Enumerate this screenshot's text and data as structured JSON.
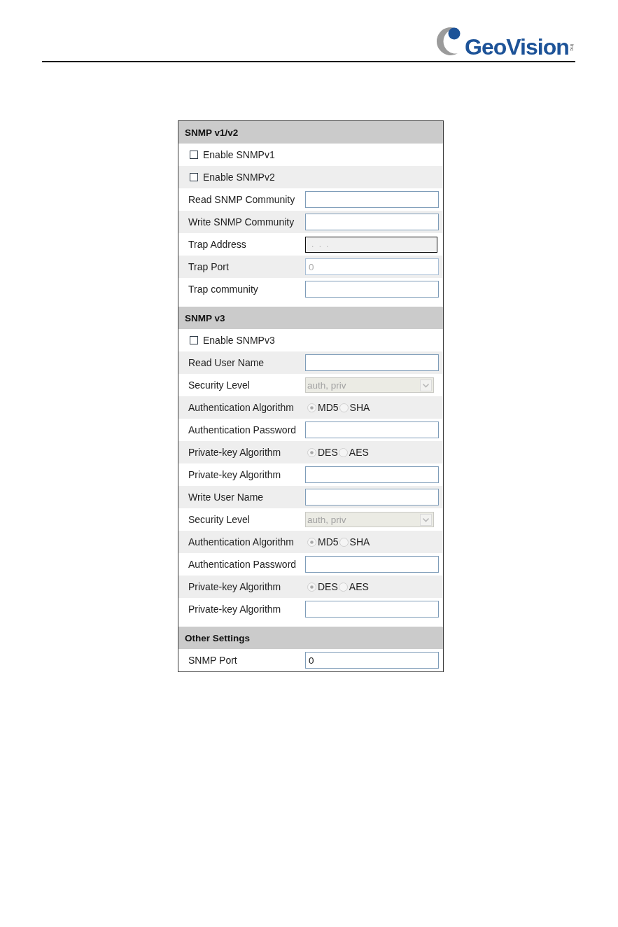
{
  "logo": {
    "wordmark": "GeoVision",
    "suffix": "inc"
  },
  "sections": [
    {
      "title": "SNMP v1/v2",
      "rows": [
        {
          "kind": "checkbox",
          "label": "Enable SNMPv1",
          "checked": false,
          "disabled": false
        },
        {
          "kind": "checkbox",
          "label": "Enable SNMPv2",
          "checked": false,
          "disabled": false
        },
        {
          "kind": "text",
          "label": "Read SNMP Community",
          "disabled": false
        },
        {
          "kind": "text",
          "label": "Write SNMP Community",
          "disabled": false
        },
        {
          "kind": "ip",
          "label": "Trap Address",
          "value": ". . .",
          "disabled": true
        },
        {
          "kind": "text",
          "label": "Trap Port",
          "value": "0",
          "disabled": true
        },
        {
          "kind": "text",
          "label": "Trap community",
          "disabled": false
        }
      ]
    },
    {
      "title": "SNMP v3",
      "rows": [
        {
          "kind": "checkbox",
          "label": "Enable SNMPv3",
          "checked": false,
          "disabled": false
        },
        {
          "kind": "text",
          "label": "Read User Name",
          "disabled": false
        },
        {
          "kind": "select",
          "label": "Security Level",
          "value": "auth, priv",
          "disabled": true
        },
        {
          "kind": "radio",
          "label": "Authentication Algorithm",
          "disabled": true,
          "options": [
            {
              "label": "MD5",
              "selected": true
            },
            {
              "label": "SHA",
              "selected": false
            }
          ]
        },
        {
          "kind": "text",
          "label": "Authentication Password",
          "disabled": false
        },
        {
          "kind": "radio",
          "label": "Private-key Algorithm",
          "disabled": true,
          "options": [
            {
              "label": "DES",
              "selected": true
            },
            {
              "label": "AES",
              "selected": false
            }
          ]
        },
        {
          "kind": "text",
          "label": "Private-key Algorithm",
          "disabled": false
        },
        {
          "kind": "text",
          "label": "Write User Name",
          "disabled": false
        },
        {
          "kind": "select",
          "label": "Security Level",
          "value": "auth, priv",
          "disabled": true
        },
        {
          "kind": "radio",
          "label": "Authentication Algorithm",
          "disabled": true,
          "options": [
            {
              "label": "MD5",
              "selected": true
            },
            {
              "label": "SHA",
              "selected": false
            }
          ]
        },
        {
          "kind": "text",
          "label": "Authentication Password",
          "disabled": false
        },
        {
          "kind": "radio",
          "label": "Private-key Algorithm",
          "disabled": true,
          "options": [
            {
              "label": "DES",
              "selected": true
            },
            {
              "label": "AES",
              "selected": false
            }
          ]
        },
        {
          "kind": "text",
          "label": "Private-key Algorithm",
          "disabled": false
        }
      ]
    },
    {
      "title": "Other Settings",
      "rows": [
        {
          "kind": "text",
          "label": "SNMP Port",
          "value": "0",
          "disabled": false
        }
      ]
    }
  ]
}
